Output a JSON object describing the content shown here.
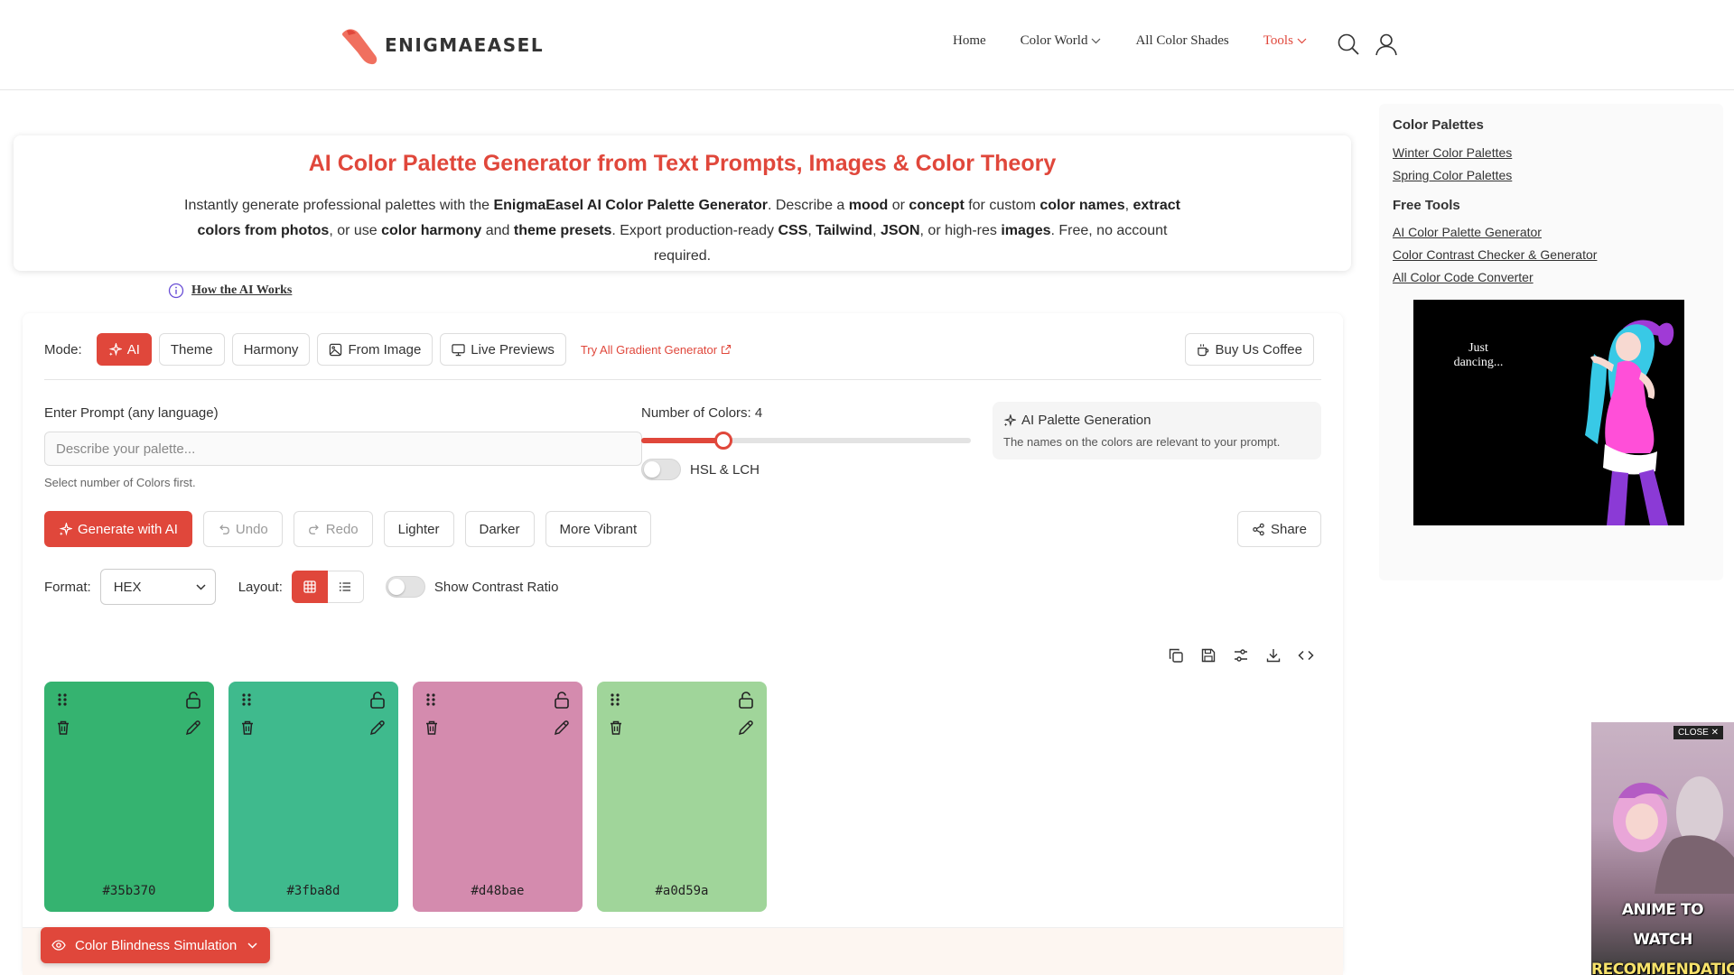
{
  "header": {
    "logo_text": "ENIGMAEASEL",
    "nav": [
      {
        "label": "Home",
        "has_dropdown": false,
        "active": false
      },
      {
        "label": "Color World",
        "has_dropdown": true,
        "active": false
      },
      {
        "label": "All Color Shades",
        "has_dropdown": false,
        "active": false
      },
      {
        "label": "Tools",
        "has_dropdown": true,
        "active": true
      }
    ],
    "icons": [
      "search-icon",
      "user-icon"
    ]
  },
  "hero": {
    "title": "AI Color Palette Generator from Text Prompts, Images & Color Theory",
    "desc_parts": [
      {
        "t": "Instantly generate professional palettes with the ",
        "b": false
      },
      {
        "t": "EnigmaEasel AI Color Palette Generator",
        "b": true
      },
      {
        "t": ". Describe a ",
        "b": false
      },
      {
        "t": "mood",
        "b": true
      },
      {
        "t": " or ",
        "b": false
      },
      {
        "t": "concept",
        "b": true
      },
      {
        "t": " for custom ",
        "b": false
      },
      {
        "t": "color names",
        "b": true
      },
      {
        "t": ", ",
        "b": false
      },
      {
        "t": "extract colors from photos",
        "b": true
      },
      {
        "t": ", or use ",
        "b": false
      },
      {
        "t": "color harmony",
        "b": true
      },
      {
        "t": " and ",
        "b": false
      },
      {
        "t": "theme presets",
        "b": true
      },
      {
        "t": ". Export production-ready ",
        "b": false
      },
      {
        "t": "CSS",
        "b": true
      },
      {
        "t": ", ",
        "b": false
      },
      {
        "t": "Tailwind",
        "b": true
      },
      {
        "t": ", ",
        "b": false
      },
      {
        "t": "JSON",
        "b": true
      },
      {
        "t": ", or high-res ",
        "b": false
      },
      {
        "t": "images",
        "b": true
      },
      {
        "t": ". Free, no account required.",
        "b": false
      }
    ]
  },
  "how_link": "How the AI Works",
  "mode": {
    "label": "Mode:",
    "buttons": [
      {
        "label": "AI",
        "icon": "sparkles-icon",
        "active": true
      },
      {
        "label": "Theme",
        "icon": "",
        "active": false
      },
      {
        "label": "Harmony",
        "icon": "",
        "active": false
      },
      {
        "label": "From Image",
        "icon": "image-icon",
        "active": false
      },
      {
        "label": "Live Previews",
        "icon": "monitor-icon",
        "active": false
      }
    ],
    "gradient_link": "Try All Gradient Generator",
    "coffee_label": "Buy Us Coffee"
  },
  "prompt": {
    "label": "Enter Prompt (any language)",
    "placeholder": "Describe your palette...",
    "value": "",
    "hint": "Select number of Colors first."
  },
  "colors_count": {
    "label": "Number of Colors: 4",
    "value": 4,
    "min": 2,
    "max": 10
  },
  "hsl_toggle": {
    "label": "HSL & LCH",
    "on": false
  },
  "ai_box": {
    "title": "AI Palette Generation",
    "desc": "The names on the colors are relevant to your prompt."
  },
  "actions": {
    "generate": "Generate with AI",
    "undo": "Undo",
    "redo": "Redo",
    "lighter": "Lighter",
    "darker": "Darker",
    "vibrant": "More Vibrant",
    "share": "Share"
  },
  "format": {
    "label": "Format:",
    "selected": "HEX",
    "layout_label": "Layout:",
    "contrast_label": "Show Contrast Ratio",
    "contrast_on": false
  },
  "tool_icons": [
    "copy-icon",
    "save-icon",
    "sliders-icon",
    "download-icon",
    "code-icon"
  ],
  "palette": [
    {
      "hex": "#35b370",
      "color": "#35b370"
    },
    {
      "hex": "#3fba8d",
      "color": "#3fba8d"
    },
    {
      "hex": "#d48bae",
      "color": "#d48bae"
    },
    {
      "hex": "#a0d59a",
      "color": "#a0d59a"
    }
  ],
  "color_blindness": {
    "label": "Color Blindness Simulation"
  },
  "sidebar": {
    "sections": [
      {
        "heading": "Color Palettes",
        "links": [
          "Winter Color Palettes",
          "Spring Color Palettes"
        ]
      },
      {
        "heading": "Free Tools",
        "links": [
          "AI Color Palette Generator",
          "Color Contrast Checker & Generator",
          "All Color Code Converter"
        ]
      }
    ]
  },
  "ads": {
    "ad1_text": "Just dancing...",
    "ad2_close": "CLOSE ✕",
    "ad2_line1": "ANIME TO WATCH",
    "ad2_line2": "RECOMMENDATIONS"
  },
  "colors": {
    "accent": "#e0473b"
  }
}
